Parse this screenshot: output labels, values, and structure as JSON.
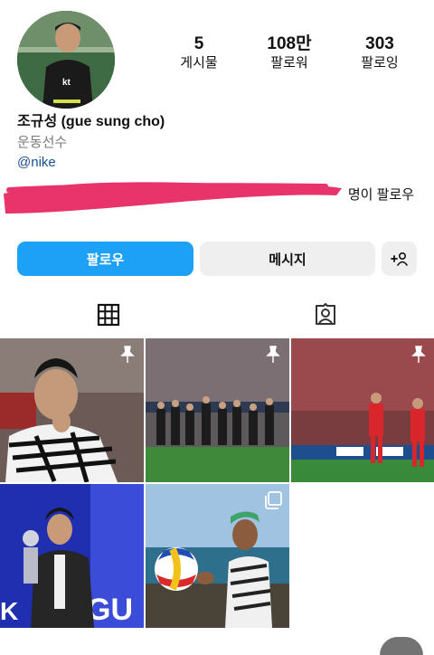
{
  "profile": {
    "name": "조규성 (gue sung cho)",
    "category": "운동선수",
    "link": "@nike",
    "followed_by": "명이 팔로우"
  },
  "stats": [
    {
      "value": "5",
      "label": "게시물"
    },
    {
      "value": "108만",
      "label": "팔로워"
    },
    {
      "value": "303",
      "label": "팔로잉"
    }
  ],
  "buttons": {
    "follow": "팔로우",
    "message": "메시지",
    "suggest": "+ㅅ"
  },
  "colors": {
    "follow_button": "#1da1f7",
    "secondary_button": "#efefef",
    "redaction_scribble": "#e8336b"
  },
  "tabs": [
    {
      "icon": "grid-icon",
      "selected": true
    },
    {
      "icon": "tagged-person-icon",
      "selected": false
    }
  ],
  "posts": [
    {
      "pinned": true,
      "kind": "pinned-icon"
    },
    {
      "pinned": true,
      "kind": "pinned-icon"
    },
    {
      "pinned": true,
      "kind": "pinned-icon"
    },
    {
      "pinned": false,
      "kind": "none"
    },
    {
      "pinned": false,
      "kind": "multi-photo-icon"
    }
  ]
}
